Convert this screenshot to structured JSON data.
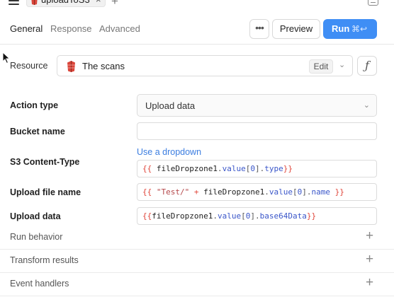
{
  "tab": {
    "label": "uploadToS3",
    "close": "×",
    "add": "+"
  },
  "header": {
    "subtabs": [
      "General",
      "Response",
      "Advanced"
    ],
    "more_label": "•••",
    "preview_label": "Preview",
    "run_label": "Run",
    "run_shortcut": "⌘↩"
  },
  "resource": {
    "label": "Resource",
    "name": "The scans",
    "edit_label": "Edit",
    "fx_label": "ƒ"
  },
  "fields": {
    "action_type": {
      "label": "Action type",
      "value": "Upload data"
    },
    "bucket_name": {
      "label": "Bucket name",
      "value": ""
    },
    "content_type": {
      "label": "S3 Content-Type",
      "link": "Use a dropdown",
      "code": [
        "{{",
        " fileDropzone1",
        ".",
        "value",
        "[",
        "0",
        "]",
        ".",
        "type",
        "}}"
      ]
    },
    "upload_file_name": {
      "label": "Upload file name",
      "code": [
        "{{",
        " ",
        "\"Test/\"",
        " + ",
        "fileDropzone1",
        ".",
        "value",
        "[",
        "0",
        "]",
        ".",
        "name",
        " }}"
      ]
    },
    "upload_data": {
      "label": "Upload data",
      "code": [
        "{{",
        "fileDropzone1",
        ".",
        "value",
        "[",
        "0",
        "]",
        ".",
        "base64Data",
        "}}"
      ]
    }
  },
  "sections": [
    {
      "label": "Run behavior",
      "icon": "+"
    },
    {
      "label": "Transform results",
      "icon": "+"
    },
    {
      "label": "Event handlers",
      "icon": "+"
    }
  ],
  "colors": {
    "accent": "#3f8ef5",
    "link": "#3b7de0",
    "brace": "#e0453a",
    "property": "#3a56c9",
    "string": "#b5484b"
  }
}
